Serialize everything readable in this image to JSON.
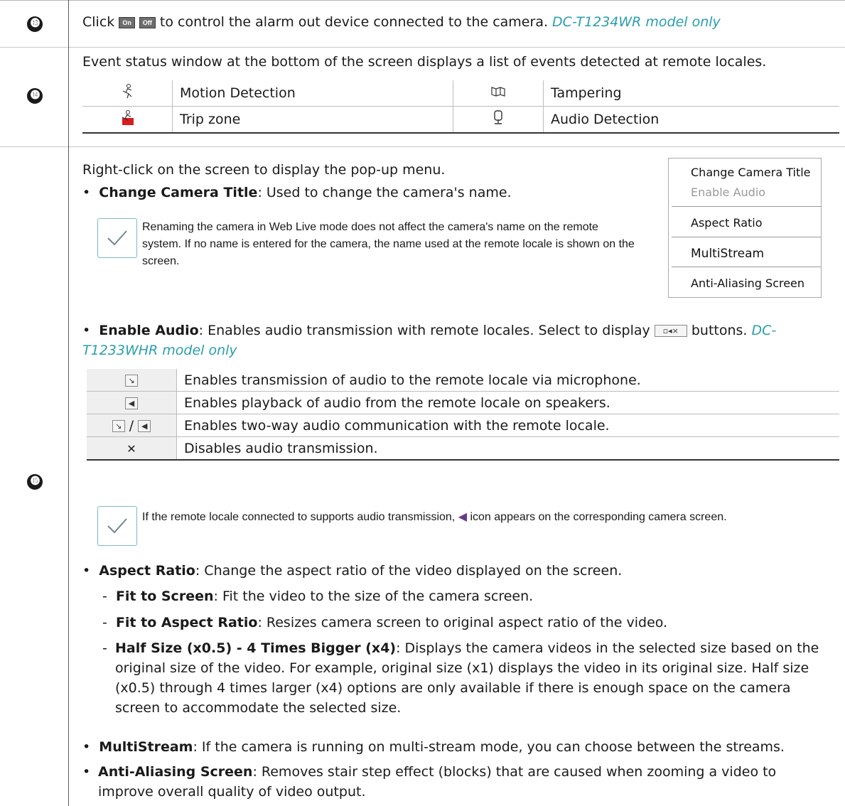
{
  "rows": {
    "r13": {
      "number": "⓭",
      "pre": "Click",
      "btn_on": "On",
      "btn_off": "Off",
      "post": "to control the alarm out device connected to the camera.",
      "model": "DC-T1234WR model only"
    },
    "r14": {
      "number": "⓮",
      "intro": "Event status window at the bottom of the screen displays a list of events detected at remote locales.",
      "events": [
        {
          "icon": "motion-icon",
          "label": "Motion Detection"
        },
        {
          "icon": "tampering-icon",
          "label": "Tampering"
        },
        {
          "icon": "trip-zone-icon",
          "label": "Trip zone"
        },
        {
          "icon": "audio-detection-icon",
          "label": "Audio Detection"
        }
      ]
    },
    "r15": {
      "number": "⓯",
      "intro": "Right-click on the screen to display the pop-up menu.",
      "change_title_label": "Change Camera Title",
      "change_title_desc": ": Used to change the camera's name.",
      "note1": "Renaming the camera in Web Live mode does not affect the camera's name on the remote system. If no name is entered for the camera, the name used at the remote locale is shown on the screen.",
      "enable_audio_label": "Enable Audio",
      "enable_audio_desc": ": Enables audio transmission with remote locales. Select to display",
      "enable_audio_post": "buttons.",
      "enable_audio_model": "DC-T1233WHR model only",
      "audio_rows": [
        {
          "icon": "mic",
          "text": "Enables transmission of audio to the remote locale via microphone."
        },
        {
          "icon": "speaker",
          "text": "Enables playback of audio from the remote locale on speakers."
        },
        {
          "icon": "mic-speaker",
          "text": "Enables two-way audio communication with the remote locale."
        },
        {
          "icon": "close",
          "text": "Disables audio transmission."
        }
      ],
      "note2_pre": "If the remote locale connected to supports audio transmission,",
      "note2_post": "icon appears on the corresponding camera screen.",
      "aspect_label": "Aspect Ratio",
      "aspect_desc": ": Change the aspect ratio of the video displayed on the screen.",
      "fit_screen_label": "Fit to Screen",
      "fit_screen_desc": ": Fit the video to the size of the camera screen.",
      "fit_aspect_label": "Fit to Aspect Ratio",
      "fit_aspect_desc": ": Resizes camera screen to original aspect ratio of the video.",
      "half_label": "Half Size (x0.5) - 4 Times Bigger (x4)",
      "half_desc": ": Displays the camera videos in the selected size based on the original size of the video. For example, original size (x1) displays the video in its original size. Half size (x0.5) through 4 times larger (x4) options are only available if there is enough space on the camera screen to accommodate the selected size.",
      "multistream_label": "MultiStream",
      "multistream_desc": ": If the camera is running on multi-stream mode, you can choose between the streams.",
      "antialias_label": "Anti-Aliasing Screen",
      "antialias_desc": ": Removes stair step effect (blocks) that are caused when zooming a video to improve overall quality of video output."
    }
  },
  "popup_menu": {
    "items": [
      "Change Camera Title",
      "Enable Audio",
      "Aspect Ratio",
      "MultiStream",
      "Anti-Aliasing Screen"
    ]
  }
}
